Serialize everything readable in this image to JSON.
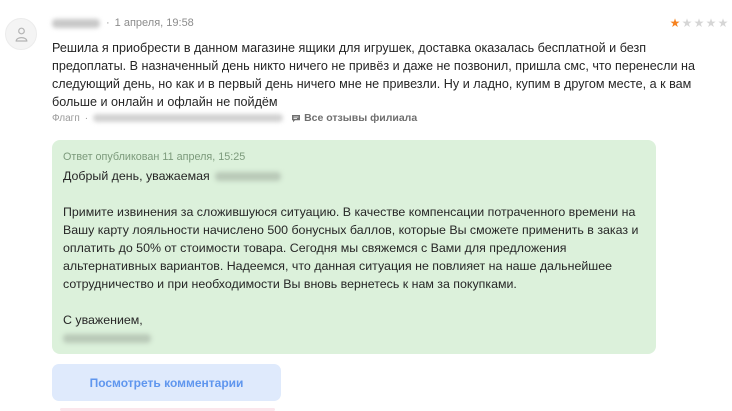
{
  "review": {
    "date": "1 апреля, 19:58",
    "rating": 1,
    "rating_max": 5,
    "text": "Решила я приобрести в данном магазине ящики для игрушек, доставка оказалась бесплатной и безп предоплаты. В назначенный день никто ничего не привёз и даже не позвонил, пришла смс, что перенесли на следующий день, но как и в первый день ничего мне не привезли. Ну и ладно, купим в другом месте, а к вам больше и онлайн и офлайн не пойдём",
    "source": "Флагп",
    "all_reviews_label": "Все отзывы филиала",
    "colors": {
      "star_filled": "#f6821f",
      "star_empty": "#d6d6d6"
    }
  },
  "reply": {
    "published": "Ответ опубликован 11 апреля, 15:25",
    "greeting": "Добрый день, уважаемая",
    "body": "Примите извинения за сложившуюся ситуацию. В качестве компенсации потраченного времени на Вашу карту лояльности начислено 500 бонусных баллов, которые Вы сможете применить в заказ и оплатить до 50% от стоимости товара. Сегодня мы свяжемся с Вами для предложения альтернативных вариантов. Надеемся, что данная ситуация не повлияет на наше дальнейшее сотрудничество и при необходимости Вы вновь вернетесь к нам за покупками.",
    "closing": "С уважением,",
    "background": "#dcf1db"
  },
  "actions": {
    "view_comments_label": "Посмотреть комментарии",
    "button_bg": "#dfeafc",
    "button_text_color": "#5f96ee"
  }
}
